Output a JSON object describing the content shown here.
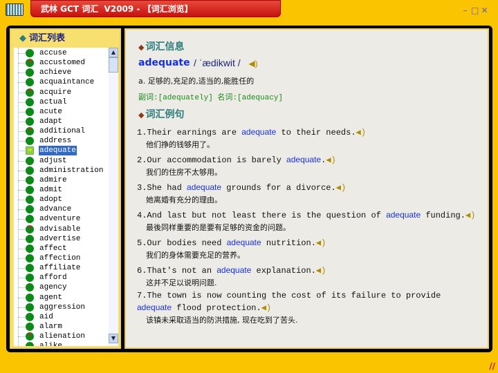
{
  "window": {
    "title": "武林 GCT 词汇  V2009 - 【词汇浏览】",
    "minimize_icon": "minimize-icon",
    "maximize_icon": "maximize-icon",
    "close_icon": "close-icon"
  },
  "colors": {
    "frame": "#fac400",
    "title_bar": "#c81010",
    "headword": "#1530e0",
    "section": "#2e7d7d",
    "forms": "#1a8a1a",
    "selection": "#316ac5"
  },
  "word_list": {
    "title": "词汇列表",
    "selected": "adequate",
    "items": [
      {
        "word": "accuse",
        "status": "known"
      },
      {
        "word": "accustomed",
        "status": "question"
      },
      {
        "word": "achieve",
        "status": "known"
      },
      {
        "word": "acquaintance",
        "status": "known"
      },
      {
        "word": "acquire",
        "status": "question"
      },
      {
        "word": "actual",
        "status": "known"
      },
      {
        "word": "acute",
        "status": "known"
      },
      {
        "word": "adapt",
        "status": "known"
      },
      {
        "word": "additional",
        "status": "question"
      },
      {
        "word": "address",
        "status": "known"
      },
      {
        "word": "adequate",
        "status": "selected"
      },
      {
        "word": "adjust",
        "status": "known"
      },
      {
        "word": "administration",
        "status": "known"
      },
      {
        "word": "admire",
        "status": "known"
      },
      {
        "word": "admit",
        "status": "known"
      },
      {
        "word": "adopt",
        "status": "known"
      },
      {
        "word": "advance",
        "status": "known"
      },
      {
        "word": "adventure",
        "status": "known"
      },
      {
        "word": "advisable",
        "status": "question"
      },
      {
        "word": "advertise",
        "status": "known"
      },
      {
        "word": "affect",
        "status": "known"
      },
      {
        "word": "affection",
        "status": "known"
      },
      {
        "word": "affiliate",
        "status": "known"
      },
      {
        "word": "afford",
        "status": "known"
      },
      {
        "word": "agency",
        "status": "known"
      },
      {
        "word": "agent",
        "status": "known"
      },
      {
        "word": "aggression",
        "status": "known"
      },
      {
        "word": "aid",
        "status": "known"
      },
      {
        "word": "alarm",
        "status": "known"
      },
      {
        "word": "alienation",
        "status": "question"
      },
      {
        "word": "alike",
        "status": "known"
      }
    ]
  },
  "info": {
    "section_title": "词汇信息",
    "headword": "adequate",
    "phonetic": "/ ˈædikwit /",
    "definition": "a.  足够的,充足的,适当的,能胜任的",
    "forms": "副词:[adequately] 名词:[adequacy]"
  },
  "examples": {
    "section_title": "词汇例句",
    "items": [
      {
        "num": "1.",
        "before": "Their earnings are ",
        "word": "adequate",
        "after": " to their needs.",
        "zh": "他们挣的钱够用了。"
      },
      {
        "num": "2.",
        "before": "Our accommodation is barely ",
        "word": "adequate",
        "after": ".",
        "zh": "我们的住房不太够用。"
      },
      {
        "num": "3.",
        "before": "She had ",
        "word": "adequate",
        "after": " grounds for a divorce.",
        "zh": "她离婚有充分的理由。"
      },
      {
        "num": "4.",
        "before": "And last but not least there is the question of ",
        "word": "adequate",
        "after": " funding.",
        "zh": "最後同样重要的是要有足够的资金的问题。"
      },
      {
        "num": "5.",
        "before": "Our bodies need ",
        "word": "adequate",
        "after": " nutrition.",
        "zh": "我们的身体需要充足的营养。"
      },
      {
        "num": "6.",
        "before": "That's not an ",
        "word": "adequate",
        "after": " explanation.",
        "zh": "这并不足以说明问题."
      },
      {
        "num": "7.",
        "before": "The town is now counting the cost of its failure to provide ",
        "word": "adequate",
        "after": " flood protection.",
        "zh": "该镇未采取适当的防洪措施, 现在吃到了苦头."
      }
    ]
  }
}
